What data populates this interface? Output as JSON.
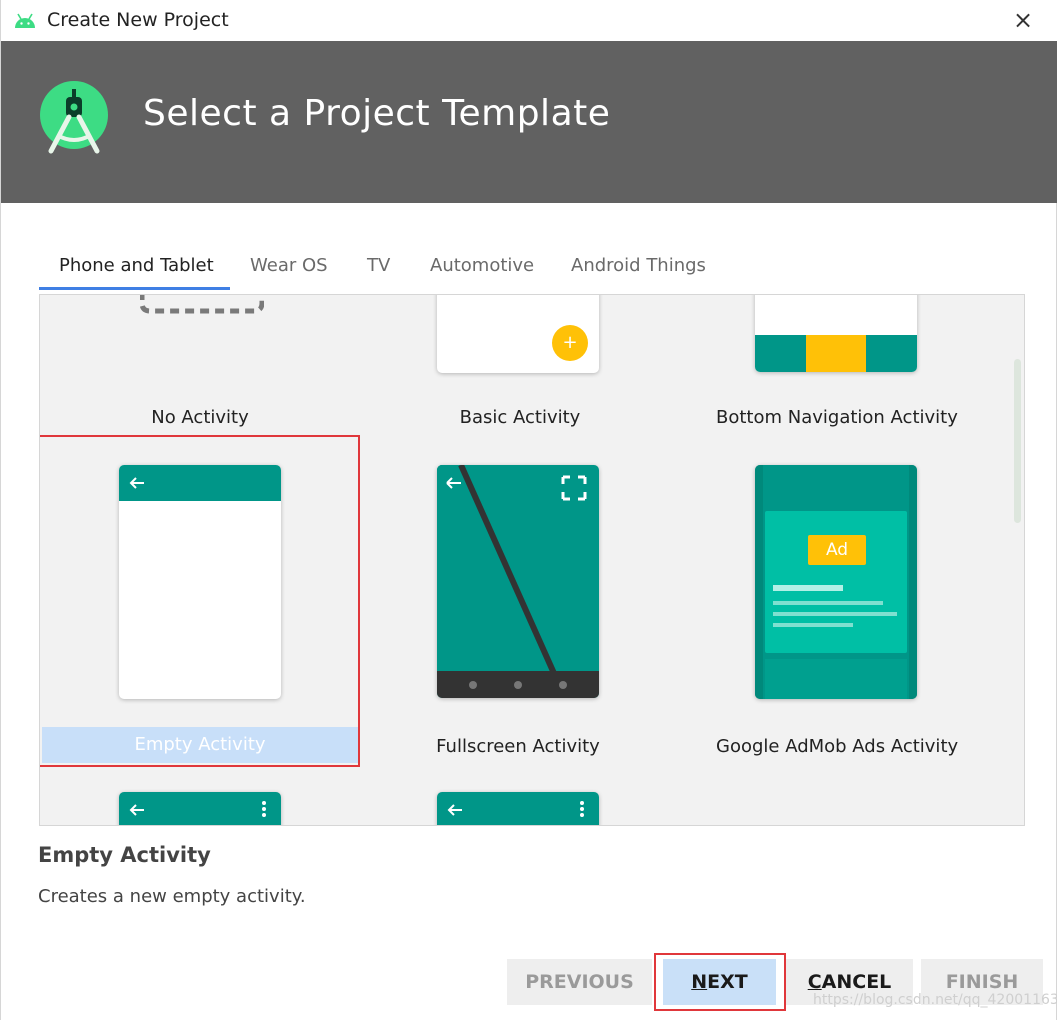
{
  "window": {
    "title": "Create New Project",
    "close_glyph": "×"
  },
  "header": {
    "title": "Select a Project Template"
  },
  "tabs": [
    {
      "label": "Phone and Tablet",
      "active": true
    },
    {
      "label": "Wear OS",
      "active": false
    },
    {
      "label": "TV",
      "active": false
    },
    {
      "label": "Automotive",
      "active": false
    },
    {
      "label": "Android Things",
      "active": false
    }
  ],
  "templates": [
    {
      "label": "No Activity",
      "selected": false
    },
    {
      "label": "Basic Activity",
      "selected": false
    },
    {
      "label": "Bottom Navigation Activity",
      "selected": false
    },
    {
      "label": "Empty Activity",
      "selected": true
    },
    {
      "label": "Fullscreen Activity",
      "selected": false
    },
    {
      "label": "Google AdMob Ads Activity",
      "selected": false
    }
  ],
  "admob": {
    "ad_label": "Ad"
  },
  "fab_glyph": "+",
  "details": {
    "title": "Empty Activity",
    "description": "Creates a new empty activity."
  },
  "buttons": {
    "previous": "PREVIOUS",
    "next": "NEXT",
    "cancel": "CANCEL",
    "finish": "FINISH"
  },
  "colors": {
    "header_bg": "#616161",
    "teal": "#009688",
    "teal_dark": "#00897b",
    "amber": "#ffc107",
    "selection_blue": "#c8dff9",
    "highlight_red": "#e0373b",
    "tab_underline": "#3f7fe4"
  },
  "watermark": "https://blog.csdn.net/qq_42001163"
}
